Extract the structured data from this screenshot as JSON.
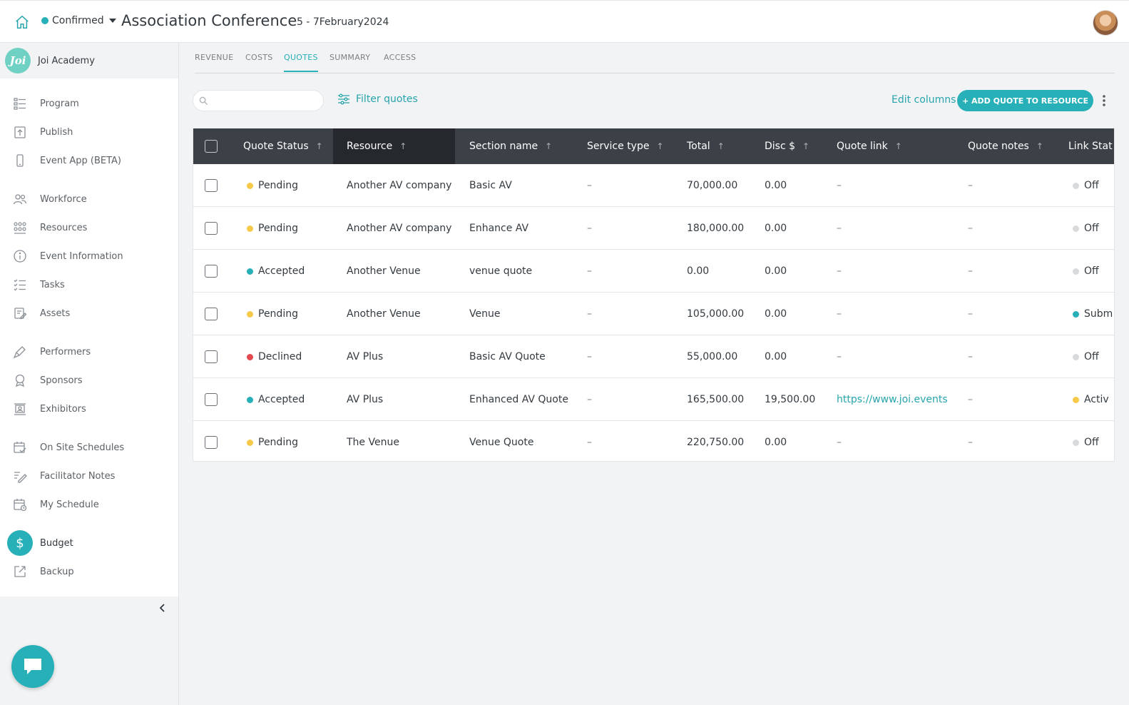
{
  "topbar": {
    "status": "Confirmed",
    "status_color": "#27b0b8",
    "title": "Association Conference",
    "dates": "5 - 7February2024",
    "home_icon": "home-icon",
    "avatar": "user-avatar"
  },
  "sidebar": {
    "org_logo": "Joi",
    "org_name": "Joi Academy",
    "items": [
      {
        "label": "Program",
        "icon": "program-icon"
      },
      {
        "label": "Publish",
        "icon": "publish-icon"
      },
      {
        "label": "Event App (BETA)",
        "icon": "phone-icon"
      },
      {
        "label": "Workforce",
        "icon": "people-icon"
      },
      {
        "label": "Resources",
        "icon": "resources-icon"
      },
      {
        "label": "Event Information",
        "icon": "info-icon"
      },
      {
        "label": "Tasks",
        "icon": "tasks-icon"
      },
      {
        "label": "Assets",
        "icon": "assets-icon"
      },
      {
        "label": "Performers",
        "icon": "microphone-icon"
      },
      {
        "label": "Sponsors",
        "icon": "award-icon"
      },
      {
        "label": "Exhibitors",
        "icon": "exhibitor-icon"
      },
      {
        "label": "On Site Schedules",
        "icon": "calendar-check-icon"
      },
      {
        "label": "Facilitator Notes",
        "icon": "notes-icon"
      },
      {
        "label": "My Schedule",
        "icon": "schedule-icon"
      },
      {
        "label": "Budget",
        "icon": "dollar-icon"
      },
      {
        "label": "Backup",
        "icon": "external-link-icon"
      }
    ],
    "active": "Budget",
    "budget_symbol": "$"
  },
  "tabs": [
    "REVENUE",
    "COSTS",
    "QUOTES",
    "SUMMARY",
    "ACCESS"
  ],
  "active_tab": "QUOTES",
  "toolbar": {
    "search_placeholder": "",
    "filter_label": "Filter quotes",
    "edit_columns_label": "Edit columns",
    "add_button_label": "+ ADD QUOTE TO RESOURCE"
  },
  "table": {
    "columns": [
      "Quote Status",
      "Resource",
      "Section name",
      "Service type",
      "Total",
      "Disc $",
      "Quote link",
      "Quote notes",
      "Link Stat"
    ],
    "sort_arrow": "↑",
    "rows": [
      {
        "status": "Pending",
        "status_color": "#f7c948",
        "resource": "Another AV company",
        "section": "Basic AV",
        "service": "–",
        "total": "70,000.00",
        "disc": "0.00",
        "link": "–",
        "notes": "–",
        "link_status": "Off",
        "link_status_color": "#d8dadc"
      },
      {
        "status": "Pending",
        "status_color": "#f7c948",
        "resource": "Another AV company",
        "section": "Enhance AV",
        "service": "–",
        "total": "180,000.00",
        "disc": "0.00",
        "link": "–",
        "notes": "–",
        "link_status": "Off",
        "link_status_color": "#d8dadc"
      },
      {
        "status": "Accepted",
        "status_color": "#27b0b8",
        "resource": "Another Venue",
        "section": "venue quote",
        "service": "–",
        "total": "0.00",
        "disc": "0.00",
        "link": "–",
        "notes": "–",
        "link_status": "Off",
        "link_status_color": "#d8dadc"
      },
      {
        "status": "Pending",
        "status_color": "#f7c948",
        "resource": "Another Venue",
        "section": "Venue",
        "service": "–",
        "total": "105,000.00",
        "disc": "0.00",
        "link": "–",
        "notes": "–",
        "link_status": "Subm",
        "link_status_color": "#27b0b8"
      },
      {
        "status": "Declined",
        "status_color": "#e5484d",
        "resource": "AV Plus",
        "section": "Basic AV Quote",
        "service": "–",
        "total": "55,000.00",
        "disc": "0.00",
        "link": "–",
        "notes": "–",
        "link_status": "Off",
        "link_status_color": "#d8dadc"
      },
      {
        "status": "Accepted",
        "status_color": "#27b0b8",
        "resource": "AV Plus",
        "section": "Enhanced AV Quote",
        "service": "–",
        "total": "165,500.00",
        "disc": "19,500.00",
        "link": "https://www.joi.events",
        "notes": "–",
        "link_status": "Activ",
        "link_status_color": "#f7c948"
      },
      {
        "status": "Pending",
        "status_color": "#f7c948",
        "resource": "The Venue",
        "section": "Venue Quote",
        "service": "–",
        "total": "220,750.00",
        "disc": "0.00",
        "link": "–",
        "notes": "–",
        "link_status": "Off",
        "link_status_color": "#d8dadc"
      }
    ]
  }
}
